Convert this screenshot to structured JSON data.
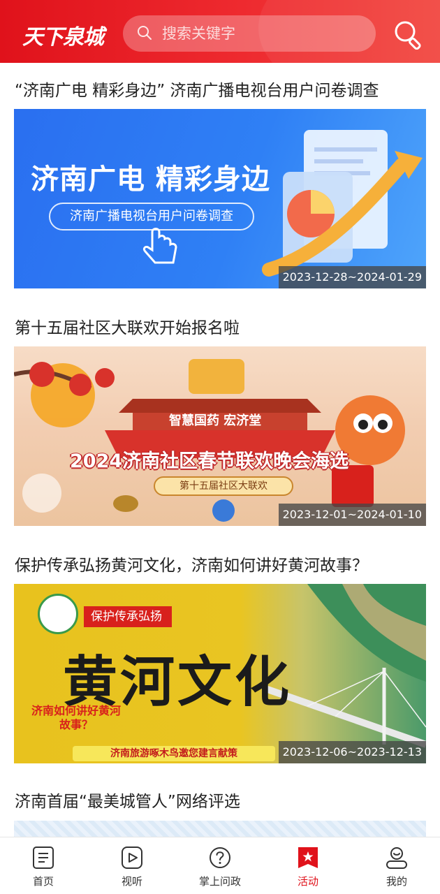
{
  "header": {
    "logo_text": "天下泉城",
    "search_placeholder": "搜索关键字",
    "icons": {
      "search_small": "search-icon",
      "search_button": "search-icon"
    },
    "colors": {
      "brand": "#e0121b"
    }
  },
  "activities": [
    {
      "title": "“济南广电 精彩身边” 济南广播电视台用户问卷调查",
      "banner_headline": "济南广电 精彩身边",
      "banner_sub": "济南广播电视台用户问卷调查",
      "date_range": "2023-12-28~2024-01-29"
    },
    {
      "title": "第十五届社区大联欢开始报名啦",
      "banner_top": "智慧国药 宏济堂",
      "banner_headline": "2024济南社区春节联欢晚会海选",
      "banner_sub": "第十五届社区大联欢",
      "date_range": "2023-12-01~2024-01-10"
    },
    {
      "title": "保护传承弘扬黄河文化，济南如何讲好黄河故事？",
      "banner_tag": "保护传承弘扬",
      "banner_headline": "黄河文化",
      "banner_question": "济南如何讲好黄河故事？",
      "banner_footer": "济南旅游啄木鸟邀您建言献策",
      "date_range": "2023-12-06~2023-12-13"
    },
    {
      "title": "济南首届“最美城管人”网络评选"
    }
  ],
  "bottom_nav": {
    "items": [
      {
        "label": "首页",
        "icon": "home-icon"
      },
      {
        "label": "视听",
        "icon": "play-icon"
      },
      {
        "label": "掌上问政",
        "icon": "question-icon"
      },
      {
        "label": "活动",
        "icon": "activity-icon",
        "active": true
      },
      {
        "label": "我的",
        "icon": "user-icon"
      }
    ],
    "colors": {
      "active": "#e0121b",
      "inactive": "#333333"
    }
  }
}
